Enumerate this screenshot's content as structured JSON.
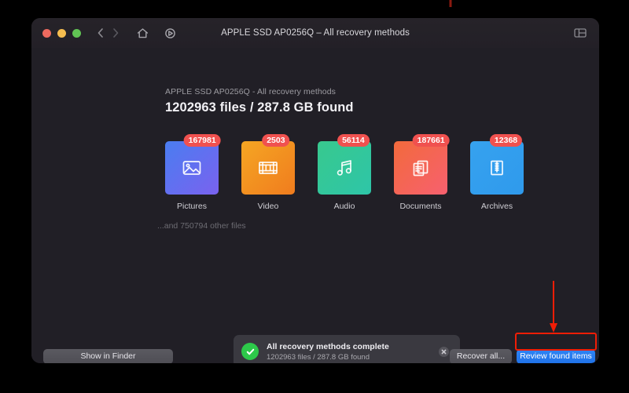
{
  "window": {
    "title": "APPLE SSD AP0256Q – All recovery methods",
    "traffic_lights": [
      "close",
      "minimize",
      "zoom"
    ],
    "nav": {
      "back": "‹",
      "forward": "›"
    },
    "toolbar_icons": [
      "home-icon",
      "history-icon",
      "panel-toggle-icon"
    ]
  },
  "header": {
    "subtitle": "APPLE SSD AP0256Q - All recovery methods",
    "title": "1202963 files / 287.8 GB found"
  },
  "categories": [
    {
      "label": "Pictures",
      "count": "167981",
      "icon": "picture-icon",
      "color_from": "#4a7df0",
      "color_to": "#7a62ef"
    },
    {
      "label": "Video",
      "count": "2503",
      "icon": "film-icon",
      "color_from": "#f5a623",
      "color_to": "#f07c1e"
    },
    {
      "label": "Audio",
      "count": "56114",
      "icon": "music-icon",
      "color_from": "#38c98e",
      "color_to": "#2ec5a8"
    },
    {
      "label": "Documents",
      "count": "187661",
      "icon": "document-icon",
      "color_from": "#f26a3c",
      "color_to": "#f7606f"
    },
    {
      "label": "Archives",
      "count": "12368",
      "icon": "archive-icon",
      "color_from": "#36a2ef",
      "color_to": "#2f9aec"
    }
  ],
  "other_files": "...and 750794 other files",
  "toast": {
    "title": "All recovery methods complete",
    "subtitle": "1202963 files / 287.8 GB found",
    "status_icon": "check-icon",
    "close_icon": "close-icon"
  },
  "actions": {
    "show_in_finder": "Show in Finder",
    "recover_all": "Recover all...",
    "review_found_items": "Review found items"
  },
  "colors": {
    "badge": "#f0514f",
    "primary_button": "#2f85f5",
    "annotation": "#f01d06",
    "success": "#2dc94a"
  }
}
